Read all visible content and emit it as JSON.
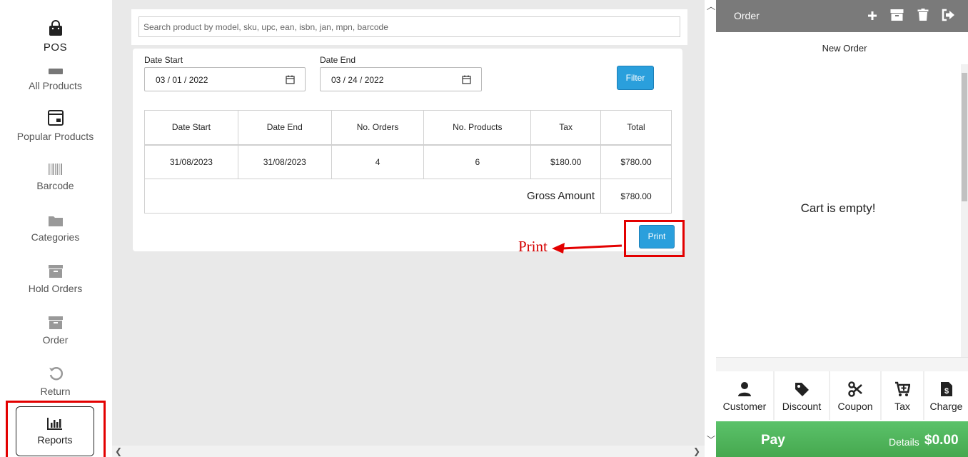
{
  "sidebar": {
    "items": [
      {
        "label": "POS",
        "icon": "shopping-bag-icon"
      },
      {
        "label": "All Products",
        "icon": "box-icon"
      },
      {
        "label": "Popular Products",
        "icon": "popular-icon"
      },
      {
        "label": "Barcode",
        "icon": "barcode-icon"
      },
      {
        "label": "Categories",
        "icon": "folder-icon"
      },
      {
        "label": "Hold Orders",
        "icon": "archive-icon"
      },
      {
        "label": "Order",
        "icon": "archive-icon"
      },
      {
        "label": "Return",
        "icon": "undo-icon"
      },
      {
        "label": "Reports",
        "icon": "bar-chart-icon"
      }
    ],
    "active": "Reports"
  },
  "search": {
    "placeholder": "Search product by model, sku, upc, ean, isbn, jan, mpn, barcode"
  },
  "report": {
    "date_start_label": "Date Start",
    "date_end_label": "Date End",
    "date_start_value": "03 / 01 / 2022",
    "date_end_value": "03 / 24 / 2022",
    "filter_label": "Filter",
    "columns": [
      "Date Start",
      "Date End",
      "No. Orders",
      "No. Products",
      "Tax",
      "Total"
    ],
    "rows": [
      [
        "31/08/2023",
        "31/08/2023",
        "4",
        "6",
        "$180.00",
        "$780.00"
      ]
    ],
    "gross_label": "Gross Amount",
    "gross_value": "$780.00",
    "print_label": "Print"
  },
  "annotation": {
    "text": "Print",
    "color": "#e30000"
  },
  "order": {
    "title": "Order",
    "new_order_label": "New Order",
    "cart_empty": "Cart is empty!",
    "actions": [
      {
        "label": "Customer",
        "icon": "user-icon"
      },
      {
        "label": "Discount",
        "icon": "tag-icon"
      },
      {
        "label": "Coupon",
        "icon": "scissors-icon"
      },
      {
        "label": "Tax",
        "icon": "cart-plus-icon"
      },
      {
        "label": "Charge",
        "icon": "dollar-file-icon"
      }
    ],
    "pay_label": "Pay",
    "details_label": "Details",
    "total": "$0.00"
  },
  "colors": {
    "accent_blue": "#2a9fdc",
    "pay_green": "#46a84f",
    "header_gray": "#7a7a7a",
    "highlight_red": "#e30000"
  }
}
